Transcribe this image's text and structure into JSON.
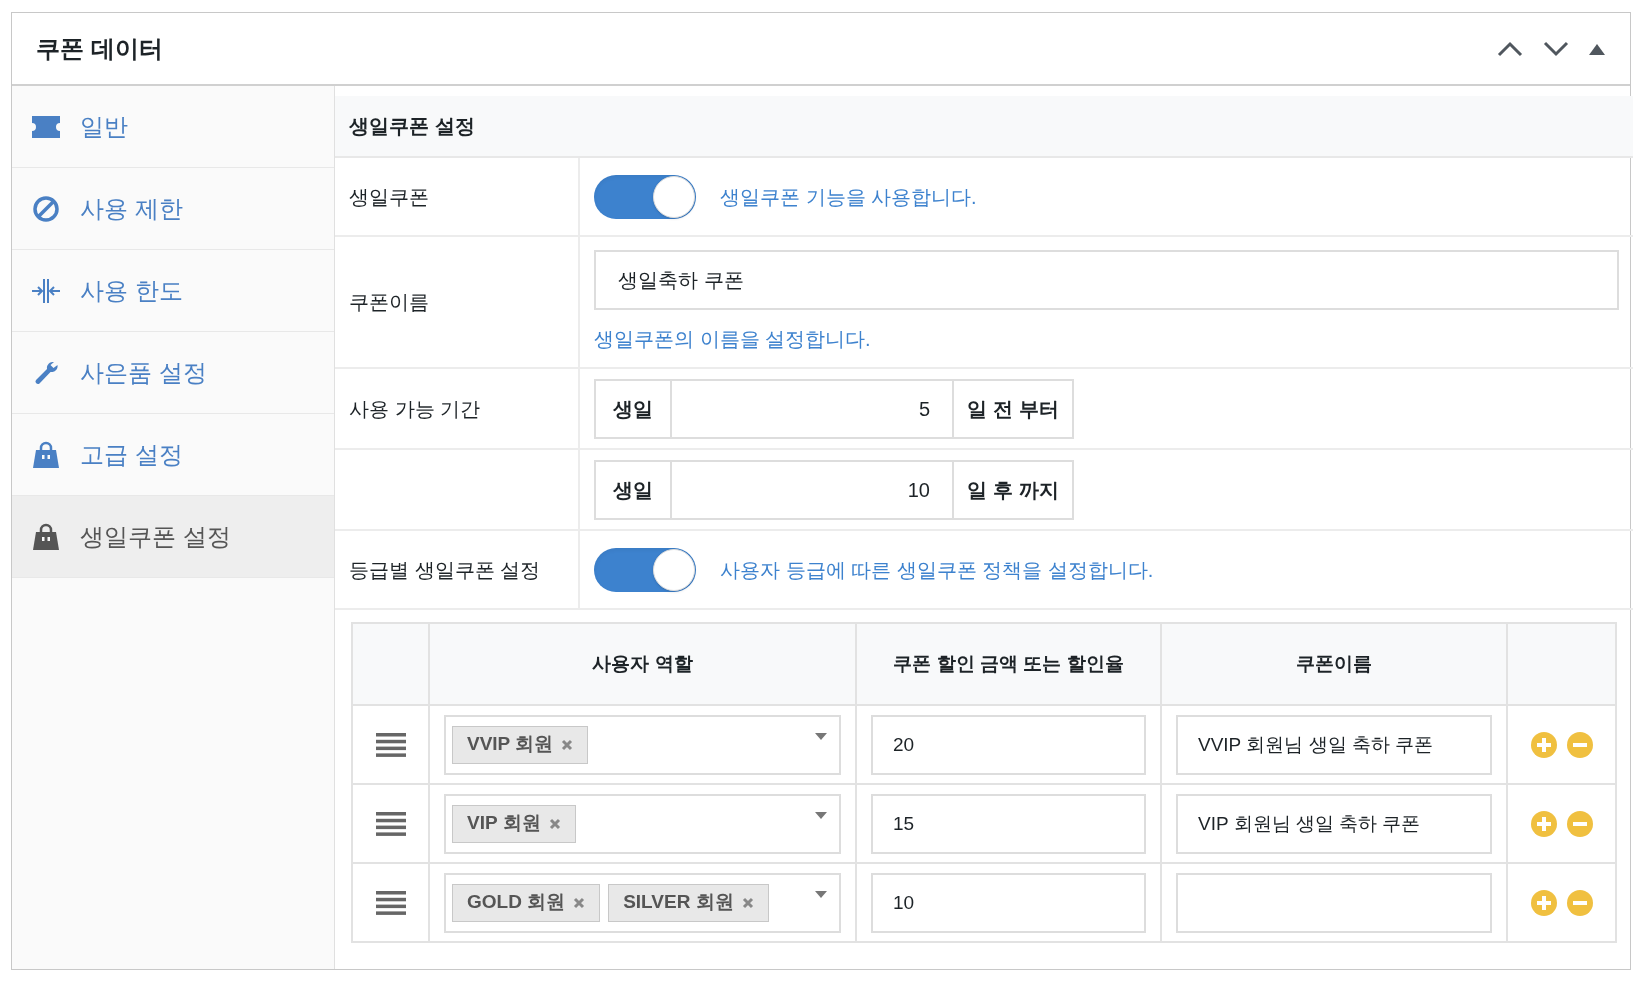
{
  "panel": {
    "title": "쿠폰 데이터"
  },
  "sidebar": {
    "items": [
      {
        "label": "일반",
        "selected": false
      },
      {
        "label": "사용 제한",
        "selected": false
      },
      {
        "label": "사용 한도",
        "selected": false
      },
      {
        "label": "사은품 설정",
        "selected": false
      },
      {
        "label": "고급 설정",
        "selected": false
      },
      {
        "label": "생일쿠폰 설정",
        "selected": true
      }
    ]
  },
  "settings": {
    "title": "생일쿠폰 설정",
    "birthday_toggle": {
      "label": "생일쿠폰",
      "on": true,
      "description": "생일쿠폰 기능을 사용합니다."
    },
    "coupon_name": {
      "label": "쿠폰이름",
      "value": "생일축하 쿠폰",
      "help": "생일쿠폰의 이름을 설정합니다."
    },
    "period": {
      "label": "사용 가능 기간",
      "rows": [
        {
          "prefix": "생일",
          "value": "5",
          "suffix": "일 전 부터"
        },
        {
          "prefix": "생일",
          "value": "10",
          "suffix": "일 후 까지"
        }
      ]
    },
    "grade_toggle": {
      "label": "등급별 생일쿠폰 설정",
      "on": true,
      "description": "사용자 등급에 따른 생일쿠폰 정책을 설정합니다."
    },
    "grade_table": {
      "columns": [
        "사용자 역할",
        "쿠폰 할인 금액 또는 할인율",
        "쿠폰이름"
      ],
      "rows": [
        {
          "roles": [
            "VVIP 회원"
          ],
          "discount": "20",
          "coupon_name": "VVIP 회원님 생일 축하 쿠폰"
        },
        {
          "roles": [
            "VIP 회원"
          ],
          "discount": "15",
          "coupon_name": "VIP 회원님 생일 축하 쿠폰"
        },
        {
          "roles": [
            "GOLD 회원",
            "SILVER 회원"
          ],
          "discount": "10"
        }
      ]
    }
  }
}
